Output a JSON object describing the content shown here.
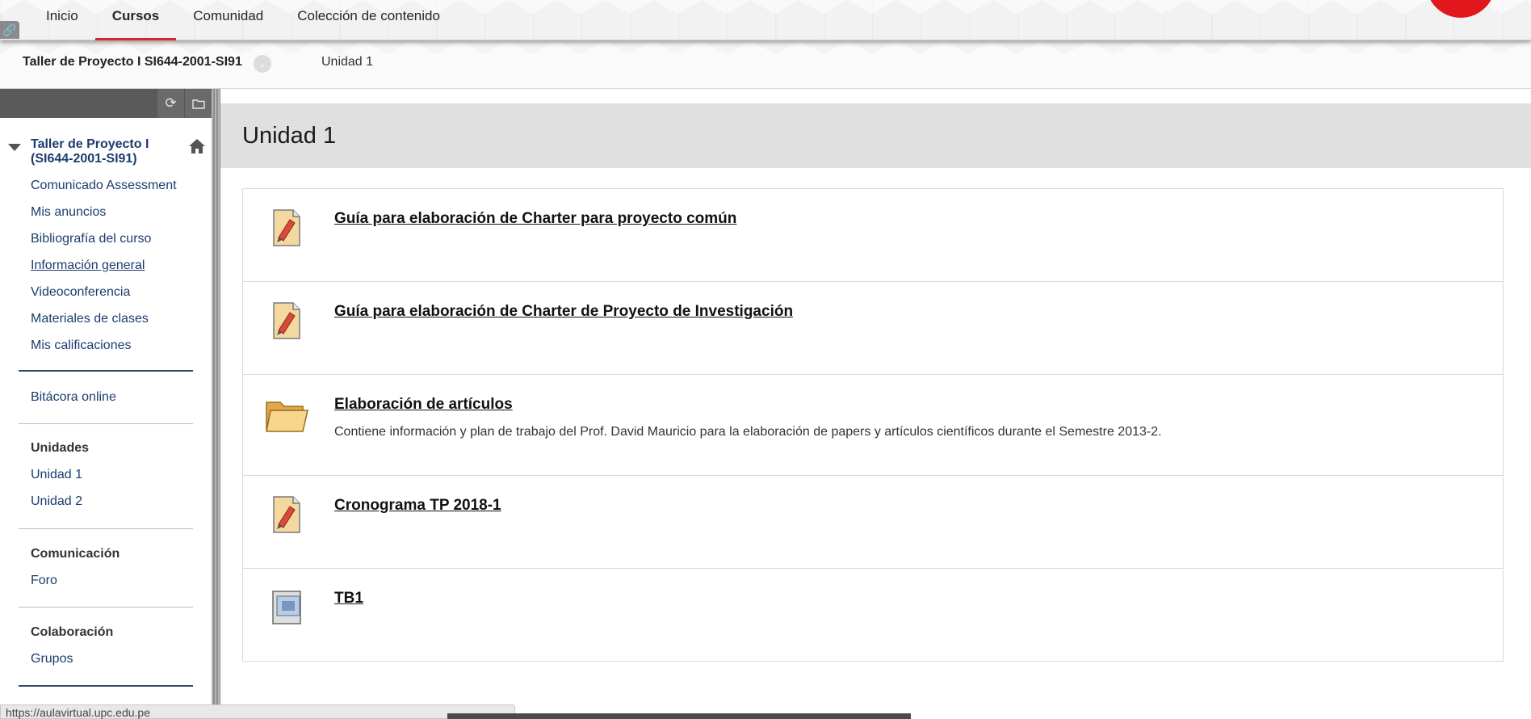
{
  "topnav": {
    "tabs": [
      {
        "label": "Inicio"
      },
      {
        "label": "Cursos",
        "active": true
      },
      {
        "label": "Comunidad"
      },
      {
        "label": "Colección de contenido"
      }
    ],
    "accent_color": "#d9262b"
  },
  "breadcrumb": {
    "course": "Taller de Proyecto I SI644-2001-SI91",
    "page": "Unidad 1"
  },
  "sidebar": {
    "course_title": "Taller de Proyecto I (SI644-2001-SI91)",
    "links_group1": [
      {
        "label": "Comunicado Assessment"
      },
      {
        "label": "Mis anuncios"
      },
      {
        "label": "Bibliografía del curso"
      },
      {
        "label": "Información general"
      },
      {
        "label": "Videoconferencia"
      },
      {
        "label": "Materiales de clases"
      },
      {
        "label": "Mis calificaciones"
      }
    ],
    "links_group2": [
      {
        "label": "Bitácora online"
      }
    ],
    "section_unidades": {
      "heading": "Unidades",
      "links": [
        {
          "label": "Unidad 1"
        },
        {
          "label": "Unidad 2"
        }
      ]
    },
    "section_comunicacion": {
      "heading": "Comunicación",
      "links": [
        {
          "label": "Foro"
        }
      ]
    },
    "section_colaboracion": {
      "heading": "Colaboración",
      "links": [
        {
          "label": "Grupos"
        }
      ]
    }
  },
  "main": {
    "title": "Unidad 1",
    "items": [
      {
        "title": "Guía para elaboración de Charter para proyecto común",
        "icon": "document-icon",
        "description": ""
      },
      {
        "title": "Guía para elaboración de Charter de Proyecto de Investigación",
        "icon": "document-icon",
        "description": ""
      },
      {
        "title": "Elaboración de artículos",
        "icon": "folder-icon",
        "description": "Contiene información y plan de trabajo del Prof. David Mauricio para la elaboración de papers y artículos científicos durante el Semestre 2013-2."
      },
      {
        "title": "Cronograma TP 2018-1",
        "icon": "document-icon",
        "description": ""
      },
      {
        "title": "TB1",
        "icon": "assignment-icon",
        "description": ""
      }
    ]
  },
  "statusbar": {
    "url": "https://aulavirtual.upc.edu.pe"
  }
}
